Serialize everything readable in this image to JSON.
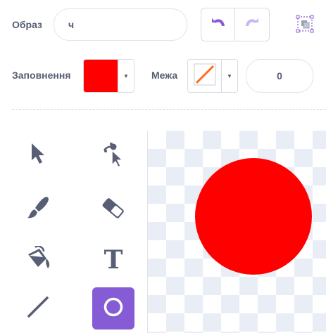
{
  "costume": {
    "label": "Образ",
    "name_value": "ч"
  },
  "history": {
    "undo_icon": "undo-icon",
    "redo_icon": "redo-icon"
  },
  "grouping": {
    "icon": "group-icon"
  },
  "fill": {
    "label": "Заповнення",
    "color": "#ff0000"
  },
  "outline": {
    "label": "Межа",
    "color": "none",
    "width_value": "0"
  },
  "tools": [
    {
      "name": "select",
      "icon": "arrow-select-icon",
      "active": false
    },
    {
      "name": "reshape",
      "icon": "reshape-icon",
      "active": false
    },
    {
      "name": "brush",
      "icon": "brush-icon",
      "active": false
    },
    {
      "name": "eraser",
      "icon": "eraser-icon",
      "active": false
    },
    {
      "name": "fill",
      "icon": "fill-bucket-icon",
      "active": false
    },
    {
      "name": "text",
      "icon": "text-icon",
      "glyph": "T",
      "active": false
    },
    {
      "name": "line",
      "icon": "line-icon",
      "active": false
    },
    {
      "name": "circle",
      "icon": "circle-icon",
      "active": true
    }
  ],
  "canvas": {
    "shape": "circle",
    "fill_color": "#ff0000"
  },
  "colors": {
    "accent": "#855cd6",
    "text": "#575e75"
  }
}
